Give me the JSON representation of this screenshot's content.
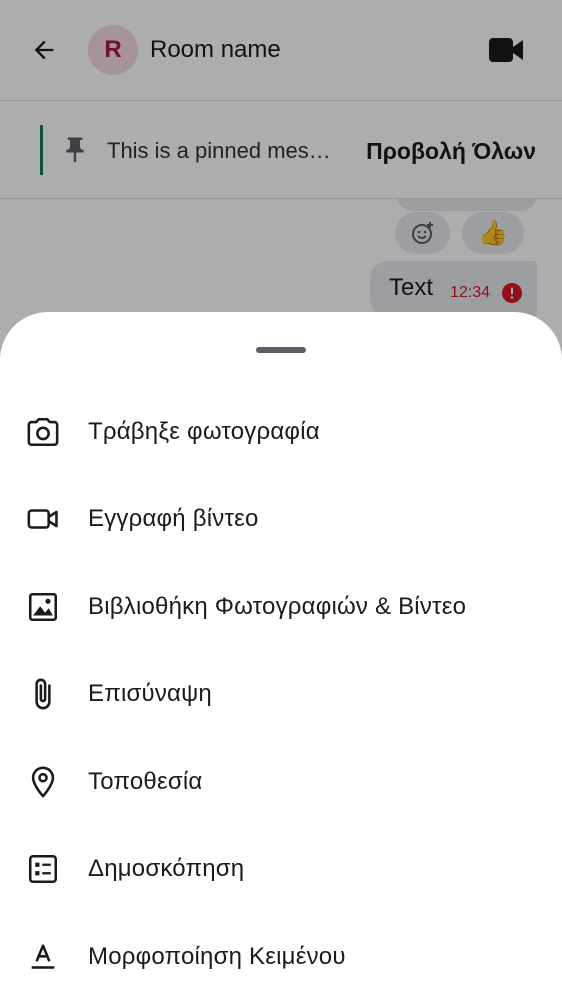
{
  "header": {
    "avatar_initial": "R",
    "room_name": "Room name"
  },
  "pinned": {
    "text": "This is a pinned message",
    "view_all_label": "Προβολή Όλων"
  },
  "timeline": {
    "message_text": "Text",
    "message_time": "12:34",
    "reaction_emoji": "👍"
  },
  "sheet": {
    "items": [
      {
        "label": "Τράβηξε φωτογραφία",
        "icon": "camera-icon"
      },
      {
        "label": "Εγγραφή βίντεο",
        "icon": "video-camera-icon"
      },
      {
        "label": "Βιβλιοθήκη Φωτογραφιών & Βίντεο",
        "icon": "image-icon"
      },
      {
        "label": "Επισύναψη",
        "icon": "paperclip-icon"
      },
      {
        "label": "Τοποθεσία",
        "icon": "location-pin-icon"
      },
      {
        "label": "Δημοσκόπηση",
        "icon": "poll-icon"
      },
      {
        "label": "Μορφοποίηση Κειμένου",
        "icon": "text-format-icon"
      }
    ]
  },
  "colors": {
    "accent_green": "#0e7b63",
    "error_red": "#d51928",
    "avatar_bg": "#f6d9e3",
    "avatar_fg": "#a0194e"
  }
}
